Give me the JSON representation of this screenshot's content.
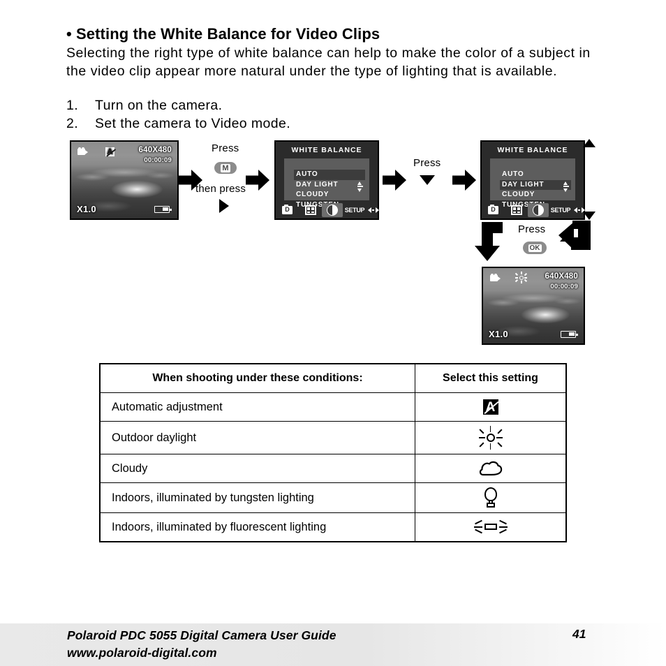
{
  "heading": "• Setting the White Balance for Video Clips",
  "paragraph": "Selecting the right type of white balance can help to make the color of a subject in the video clip appear more natural under the type of lighting that is available.",
  "steps": [
    {
      "num": "1.",
      "text": "Turn on the camera."
    },
    {
      "num": "2.",
      "text": "Set the camera to Video mode."
    }
  ],
  "lcd_before": {
    "mode_icon": "camcorder-icon",
    "wb_icon": "wb-auto-icon",
    "resolution": "640X480",
    "time": "00:00:09",
    "zoom": "X1.0",
    "battery_icon": "battery-icon"
  },
  "lcd_after": {
    "mode_icon": "camcorder-icon",
    "wb_icon": "wb-daylight-sun-icon",
    "resolution": "640X480",
    "time": "00:00:09",
    "zoom": "X1.0",
    "battery_icon": "battery-icon"
  },
  "flow": {
    "press_1": "Press",
    "button_m": "M",
    "then_press": "then press",
    "then_press_icon": "triangle-right-icon",
    "press_2": "Press",
    "press_2_icon": "triangle-down-icon",
    "press_3": "Press",
    "button_ok": "OK"
  },
  "menu_1": {
    "title": "WHITE BALANCE",
    "items": [
      "AUTO",
      "DAY LIGHT",
      "CLOUDY",
      "TUNGSTEN"
    ],
    "selected_index": 0,
    "scroll_icon": "scroll-up-down-icon",
    "tabs": [
      {
        "icon": "capture-mode-icon",
        "label": ""
      },
      {
        "icon": "quality-grid-icon",
        "label": ""
      },
      {
        "icon": "contrast-circle-icon",
        "label": ""
      },
      {
        "icon": "setup-icon",
        "label": "SETUP"
      },
      {
        "icon": "left-right-arrows-icon",
        "label": ""
      }
    ],
    "selected_tab_index": 2
  },
  "menu_2": {
    "title": "WHITE BALANCE",
    "items": [
      "AUTO",
      "DAY LIGHT",
      "CLOUDY",
      "TUNGSTEN"
    ],
    "selected_index": 1,
    "scroll_icon": "scroll-up-down-icon",
    "tabs": [
      {
        "icon": "capture-mode-icon",
        "label": ""
      },
      {
        "icon": "quality-grid-icon",
        "label": ""
      },
      {
        "icon": "contrast-circle-icon",
        "label": ""
      },
      {
        "icon": "setup-icon",
        "label": "SETUP"
      },
      {
        "icon": "left-right-arrows-icon",
        "label": ""
      }
    ],
    "selected_tab_index": 2
  },
  "table": {
    "headers": [
      "When shooting under these conditions:",
      "Select this setting"
    ],
    "rows": [
      {
        "condition": "Automatic adjustment",
        "icon": "wb-auto-icon"
      },
      {
        "condition": "Outdoor daylight",
        "icon": "wb-daylight-sun-icon"
      },
      {
        "condition": "Cloudy",
        "icon": "wb-cloudy-icon"
      },
      {
        "condition": "Indoors, illuminated by tungsten lighting",
        "icon": "wb-tungsten-bulb-icon"
      },
      {
        "condition": "Indoors, illuminated by fluorescent lighting",
        "icon": "wb-fluorescent-icon"
      }
    ]
  },
  "footer": {
    "line1": "Polaroid PDC 5055 Digital Camera User Guide",
    "line2": "www.polaroid-digital.com",
    "page": "41"
  }
}
